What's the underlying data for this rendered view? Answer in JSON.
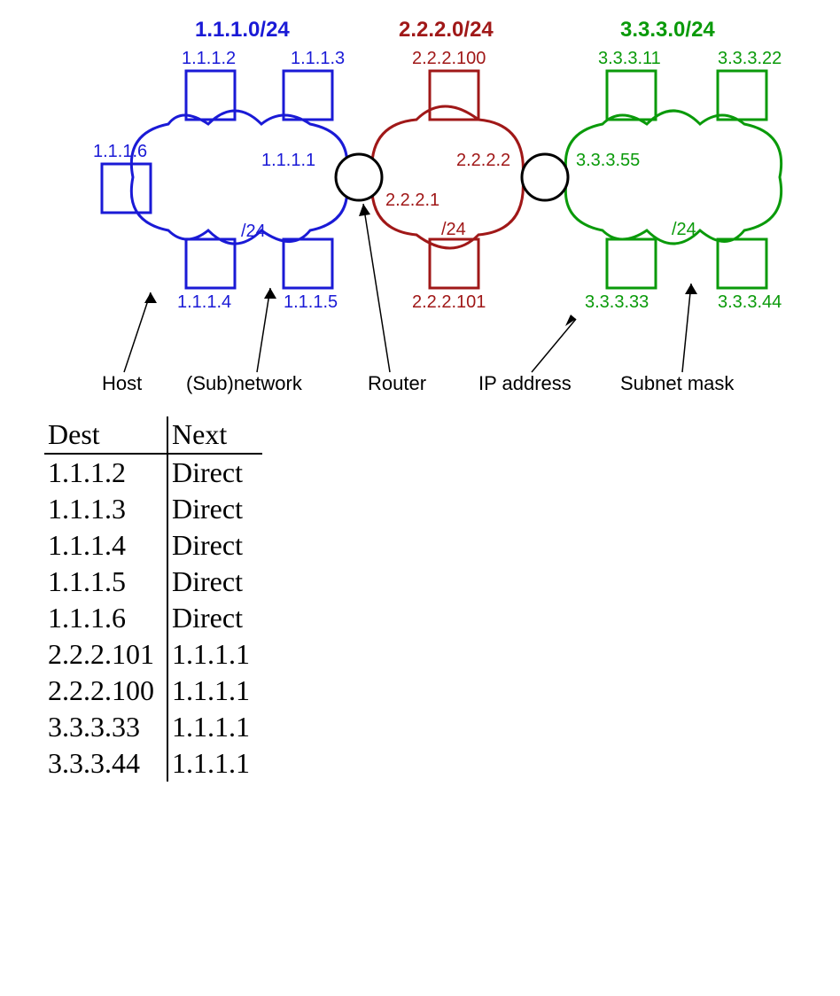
{
  "networks": {
    "blue": {
      "title": "1.1.1.0/24",
      "color": "#1a1ad6"
    },
    "red": {
      "title": "2.2.2.0/24",
      "color": "#a01818"
    },
    "green": {
      "title": "3.3.3.0/24",
      "color": "#0a9a0a"
    }
  },
  "hosts": {
    "blue": {
      "h2": "1.1.1.2",
      "h3": "1.1.1.3",
      "h4": "1.1.1.4",
      "h5": "1.1.1.5",
      "h6": "1.1.1.6"
    },
    "red": {
      "h100": "2.2.2.100",
      "h101": "2.2.2.101"
    },
    "green": {
      "h11": "3.3.3.11",
      "h22": "3.3.3.22",
      "h33": "3.3.3.33",
      "h44": "3.3.3.44"
    }
  },
  "router_ifaces": {
    "left": {
      "inside_blue": "1.1.1.1",
      "inside_red": "2.2.2.1"
    },
    "right": {
      "inside_red": "2.2.2.2",
      "inside_green": "3.3.3.55"
    }
  },
  "mask_label": "/24",
  "legend": {
    "host": "Host",
    "subnet": "(Sub)network",
    "router": "Router",
    "ip": "IP address",
    "mask": "Subnet mask"
  },
  "routing_table": {
    "headers": {
      "dest": "Dest",
      "next": "Next"
    },
    "rows": [
      {
        "dest": "1.1.1.2",
        "next": "Direct"
      },
      {
        "dest": "1.1.1.3",
        "next": "Direct"
      },
      {
        "dest": "1.1.1.4",
        "next": "Direct"
      },
      {
        "dest": "1.1.1.5",
        "next": "Direct"
      },
      {
        "dest": "1.1.1.6",
        "next": "Direct"
      },
      {
        "dest": "2.2.2.101",
        "next": "1.1.1.1"
      },
      {
        "dest": "2.2.2.100",
        "next": "1.1.1.1"
      },
      {
        "dest": "3.3.3.33",
        "next": "1.1.1.1"
      },
      {
        "dest": "3.3.3.44",
        "next": "1.1.1.1"
      }
    ]
  }
}
